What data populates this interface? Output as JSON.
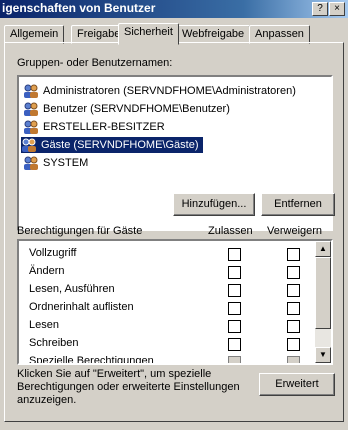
{
  "window": {
    "title": "igenschaften von Benutzer",
    "help_glyph": "?",
    "close_glyph": "×"
  },
  "tabs": [
    {
      "label": "Allgemein"
    },
    {
      "label": "Freigabe"
    },
    {
      "label": "Sicherheit",
      "active": true
    },
    {
      "label": "Webfreigabe"
    },
    {
      "label": "Anpassen"
    }
  ],
  "groups": {
    "label": "Gruppen- oder Benutzernamen:",
    "items": [
      {
        "name": "Administratoren (SERVNDFHOME\\Administratoren)"
      },
      {
        "name": "Benutzer (SERVNDFHOME\\Benutzer)"
      },
      {
        "name": "ERSTELLER-BESITZER"
      },
      {
        "name": "Gäste (SERVNDFHOME\\Gäste)",
        "selected": true
      },
      {
        "name": "SYSTEM"
      }
    ],
    "add_button": "Hinzufügen...",
    "remove_button": "Entfernen"
  },
  "permissions": {
    "label": "Berechtigungen für Gäste",
    "allow_header": "Zulassen",
    "deny_header": "Verweigern",
    "rows": [
      {
        "name": "Vollzugriff"
      },
      {
        "name": "Ändern"
      },
      {
        "name": "Lesen, Ausführen"
      },
      {
        "name": "Ordnerinhalt auflisten"
      },
      {
        "name": "Lesen"
      },
      {
        "name": "Schreiben"
      },
      {
        "name": "Spezielle Berechtigungen"
      }
    ]
  },
  "footer": {
    "text": "Klicken Sie auf \"Erweitert\", um spezielle Berechtigungen oder erweiterte Einstellungen anzuzeigen.",
    "advanced_button": "Erweitert"
  },
  "colors": {
    "selection": "#0a246a",
    "title_start": "#0a246a",
    "face": "#d4d0c8"
  },
  "icons": {
    "user": "users-group-icon",
    "scroll_up": "up-arrow-icon",
    "scroll_down": "down-arrow-icon"
  }
}
